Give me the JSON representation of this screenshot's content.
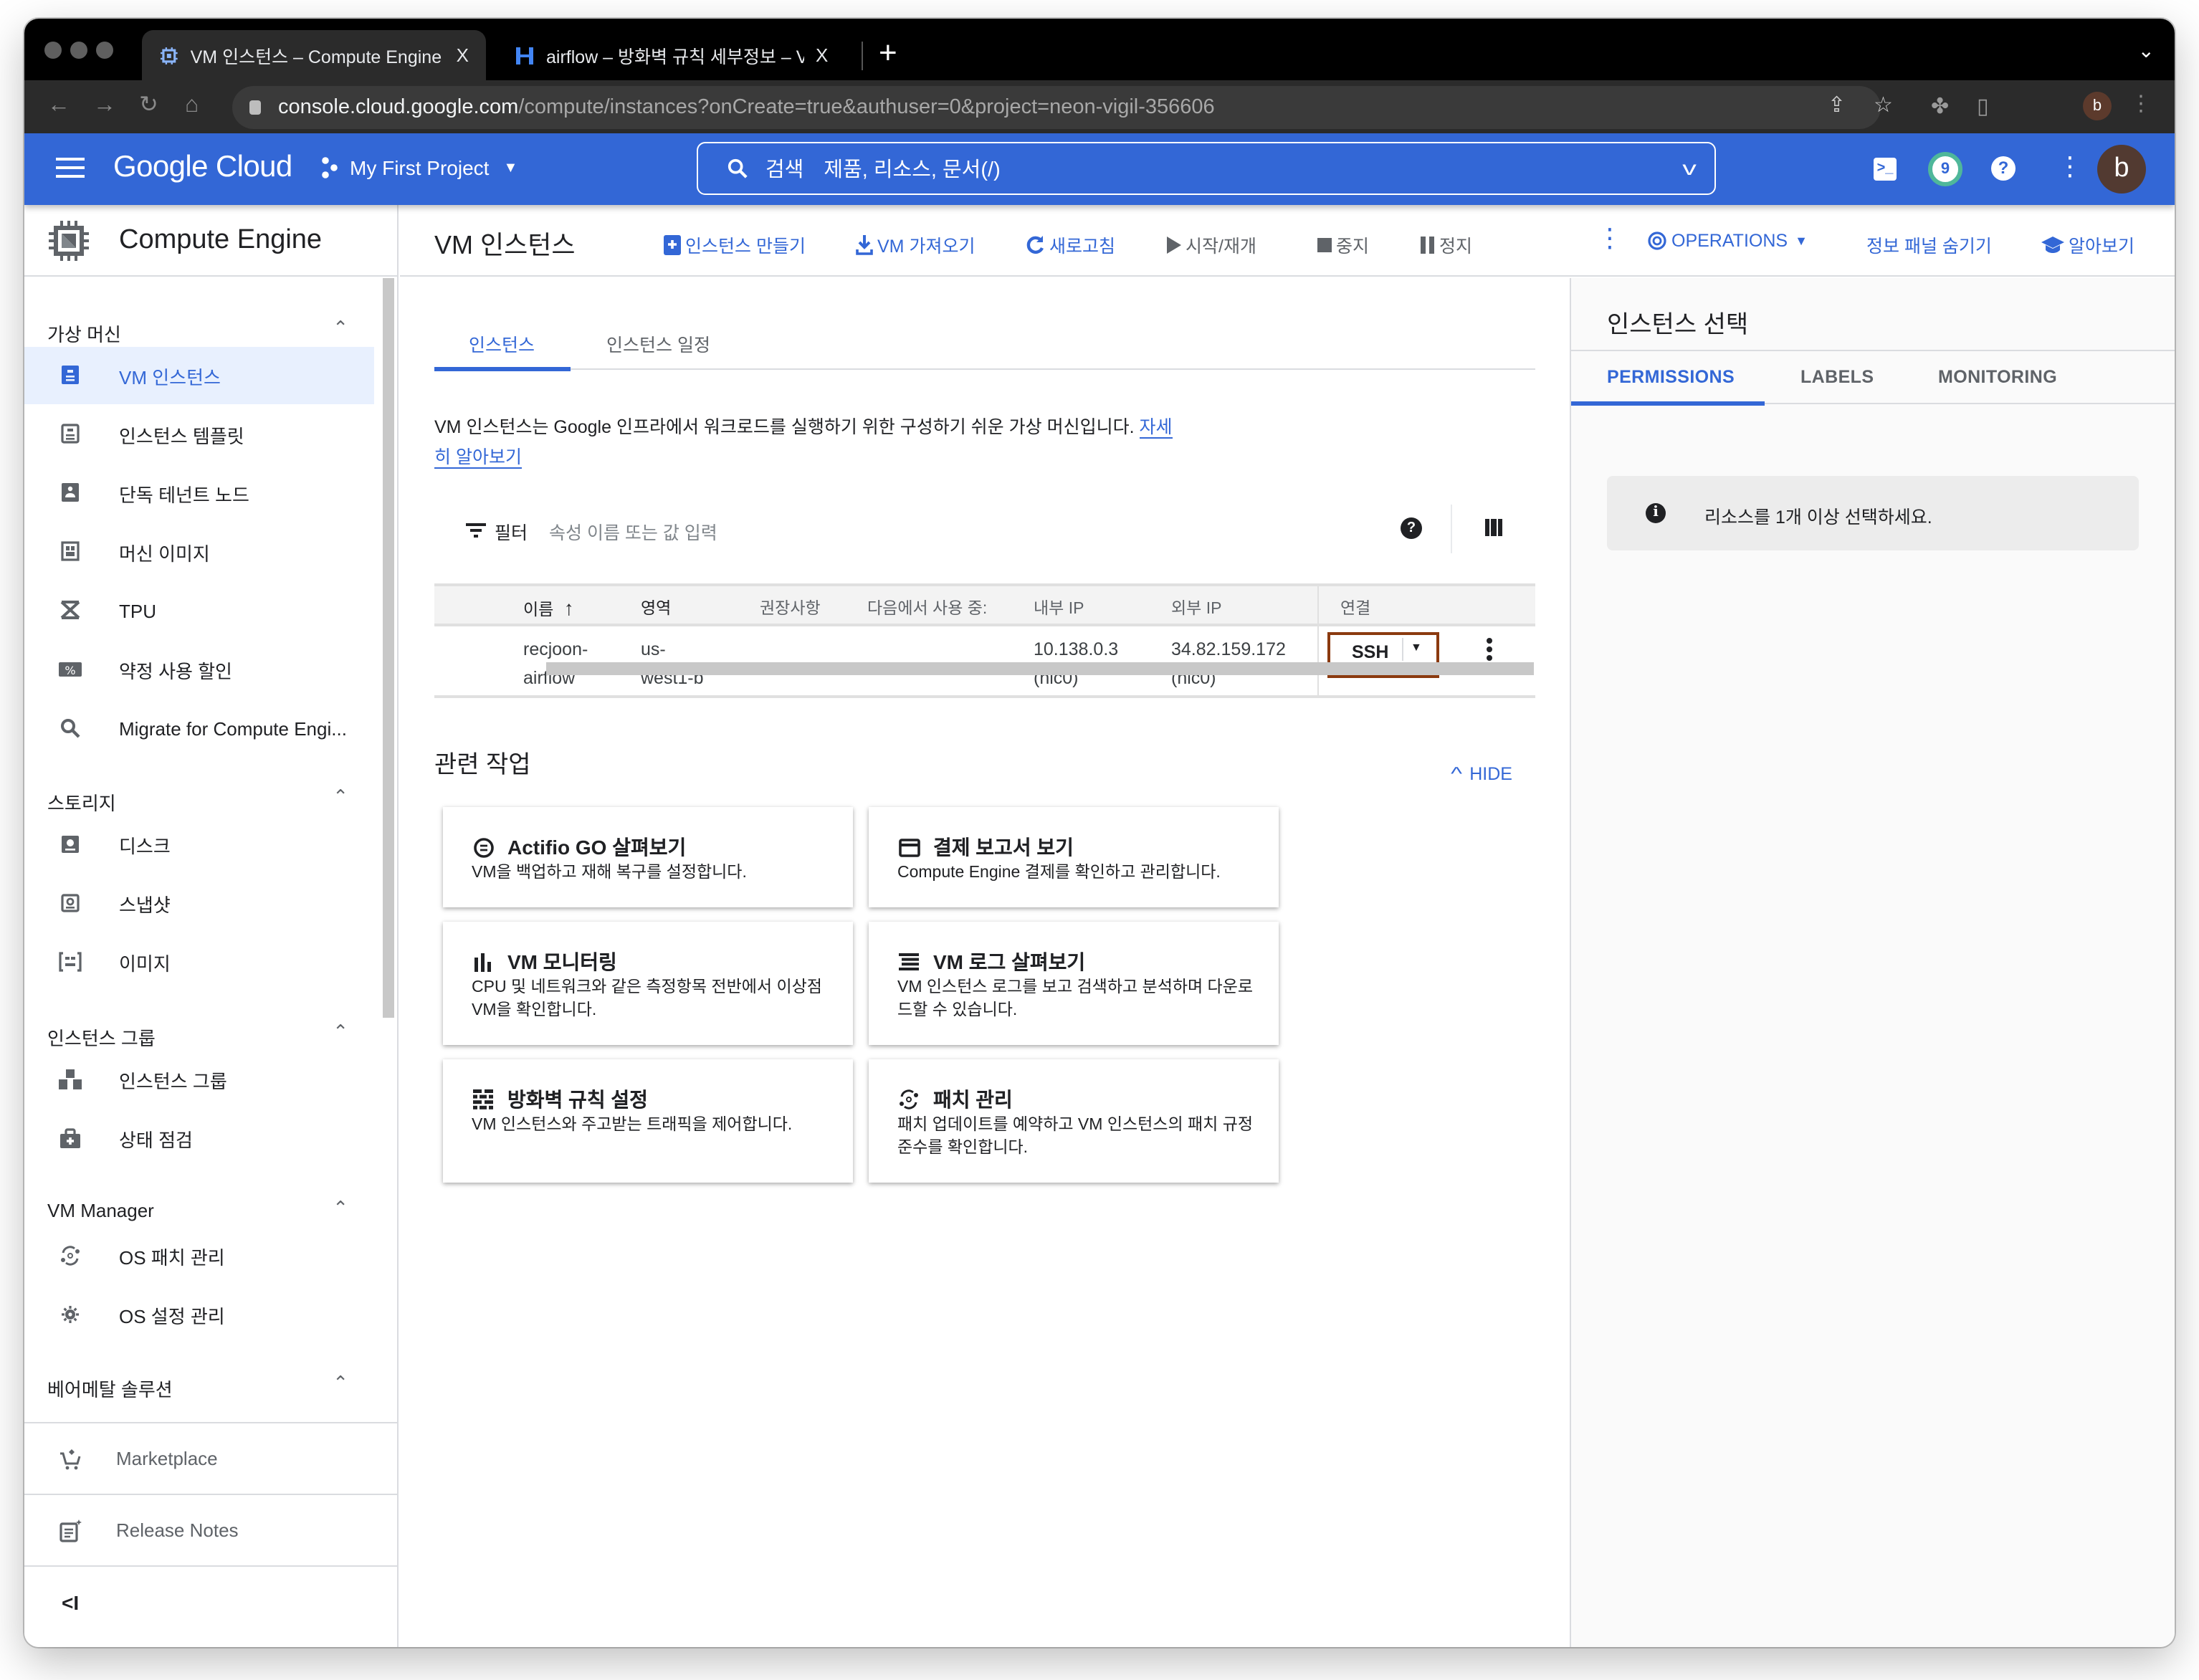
{
  "browser": {
    "tabs": [
      {
        "title": "VM 인스턴스 – Compute Engine",
        "active": true,
        "close": "X"
      },
      {
        "title": "airflow – 방화벽 규칙 세부정보 – V",
        "active": false,
        "close": "X"
      }
    ],
    "new_tab": "+",
    "tab_menu": "⌄",
    "url_host": "console.cloud.google.com",
    "url_path": "/compute/instances?onCreate=true&authuser=0&project=neon-vigil-356606",
    "profile_initial": "b"
  },
  "header": {
    "brand": "Google Cloud",
    "project": "My First Project",
    "search_label": "검색",
    "search_placeholder": "제품, 리소스, 문서(/)",
    "cloud_shell": ">_",
    "notification_count": "9",
    "help": "?",
    "avatar_initial": "b",
    "colors": {
      "header_bg": "#3367d6",
      "notification_ring": "#4fb79a",
      "avatar_bg": "#523a31"
    }
  },
  "sidebar": {
    "product": "Compute Engine",
    "sections": [
      {
        "title": "가상 머신",
        "items": [
          {
            "label": "VM 인스턴스",
            "icon": "vm-instance-icon",
            "active": true
          },
          {
            "label": "인스턴스 템플릿",
            "icon": "instance-template-icon"
          },
          {
            "label": "단독 테넌트 노드",
            "icon": "sole-tenant-node-icon"
          },
          {
            "label": "머신 이미지",
            "icon": "machine-image-icon"
          },
          {
            "label": "TPU",
            "icon": "tpu-icon"
          },
          {
            "label": "약정 사용 할인",
            "icon": "discount-icon"
          },
          {
            "label": "Migrate for Compute Engi...",
            "icon": "search-icon"
          }
        ]
      },
      {
        "title": "스토리지",
        "items": [
          {
            "label": "디스크",
            "icon": "disk-icon"
          },
          {
            "label": "스냅샷",
            "icon": "snapshot-icon"
          },
          {
            "label": "이미지",
            "icon": "image-icon"
          }
        ]
      },
      {
        "title": "인스턴스 그룹",
        "items": [
          {
            "label": "인스턴스 그룹",
            "icon": "instance-group-icon"
          },
          {
            "label": "상태 점검",
            "icon": "health-check-icon"
          }
        ]
      },
      {
        "title": "VM Manager",
        "items": [
          {
            "label": "OS 패치 관리",
            "icon": "patch-icon"
          },
          {
            "label": "OS 설정 관리",
            "icon": "settings-icon"
          }
        ]
      },
      {
        "title": "베어메탈 솔루션",
        "items": []
      }
    ],
    "marketplace": "Marketplace",
    "release_notes": "Release Notes",
    "collapse": "<I"
  },
  "actionbar": {
    "title": "VM 인스턴스",
    "create": "인스턴스 만들기",
    "import": "VM 가져오기",
    "refresh": "새로고침",
    "start": "시작/재개",
    "stop": "중지",
    "suspend": "정지",
    "operations": "OPERATIONS",
    "hide_panel": "정보 패널 숨기기",
    "learn": "알아보기"
  },
  "main": {
    "tabs": [
      "인스턴스",
      "인스턴스 일정"
    ],
    "intro": "VM 인스턴스는 Google 인프라에서 워크로드를 실행하기 위한 구성하기 쉬운 가상 머신입니다. ",
    "intro_link_1": "자세",
    "intro_link_2": "히 알아보기",
    "filter_label": "필터",
    "filter_placeholder": "속성 이름 또는 값 입력",
    "table": {
      "columns": [
        "이름",
        "영역",
        "권장사항",
        "다음에서 사용 중:",
        "내부 IP",
        "외부 IP",
        "연결"
      ],
      "sort_indicator": "↑",
      "rows": [
        {
          "name_1": "recjoon-",
          "name_2": "airflow",
          "zone_1": "us-",
          "zone_2": "west1-b",
          "recommendation": "",
          "in_use_by": "",
          "internal_ip": "10.138.0.3",
          "internal_nic": "(nic0)",
          "external_ip": "34.82.159.172",
          "external_nic": "(nic0)",
          "connect": "SSH"
        }
      ]
    },
    "related_title": "관련 작업",
    "hide": "HIDE",
    "cards": [
      {
        "title": "Actifio GO 살펴보기",
        "desc": "VM을 백업하고 재해 복구를 설정합니다.",
        "icon": "actifio-icon"
      },
      {
        "title": "결제 보고서 보기",
        "desc": "Compute Engine 결제를 확인하고 관리합니다.",
        "icon": "billing-icon"
      },
      {
        "title": "VM 모니터링",
        "desc": "CPU 및 네트워크와 같은 측정항목 전반에서 이상점 VM을 확인합니다.",
        "icon": "monitoring-icon"
      },
      {
        "title": "VM 로그 살펴보기",
        "desc": "VM 인스턴스 로그를 보고 검색하고 분석하며 다운로드할 수 있습니다.",
        "icon": "logs-icon"
      },
      {
        "title": "방화벽 규칙 설정",
        "desc": "VM 인스턴스와 주고받는 트래픽을 제어합니다.",
        "icon": "firewall-icon"
      },
      {
        "title": "패치 관리",
        "desc": "패치 업데이트를 예약하고 VM 인스턴스의 패치 규정 준수를 확인합니다.",
        "icon": "patch-icon"
      }
    ]
  },
  "info_panel": {
    "title": "인스턴스 선택",
    "tabs": [
      "PERMISSIONS",
      "LABELS",
      "MONITORING"
    ],
    "message": "리소스를 1개 이상 선택하세요."
  }
}
